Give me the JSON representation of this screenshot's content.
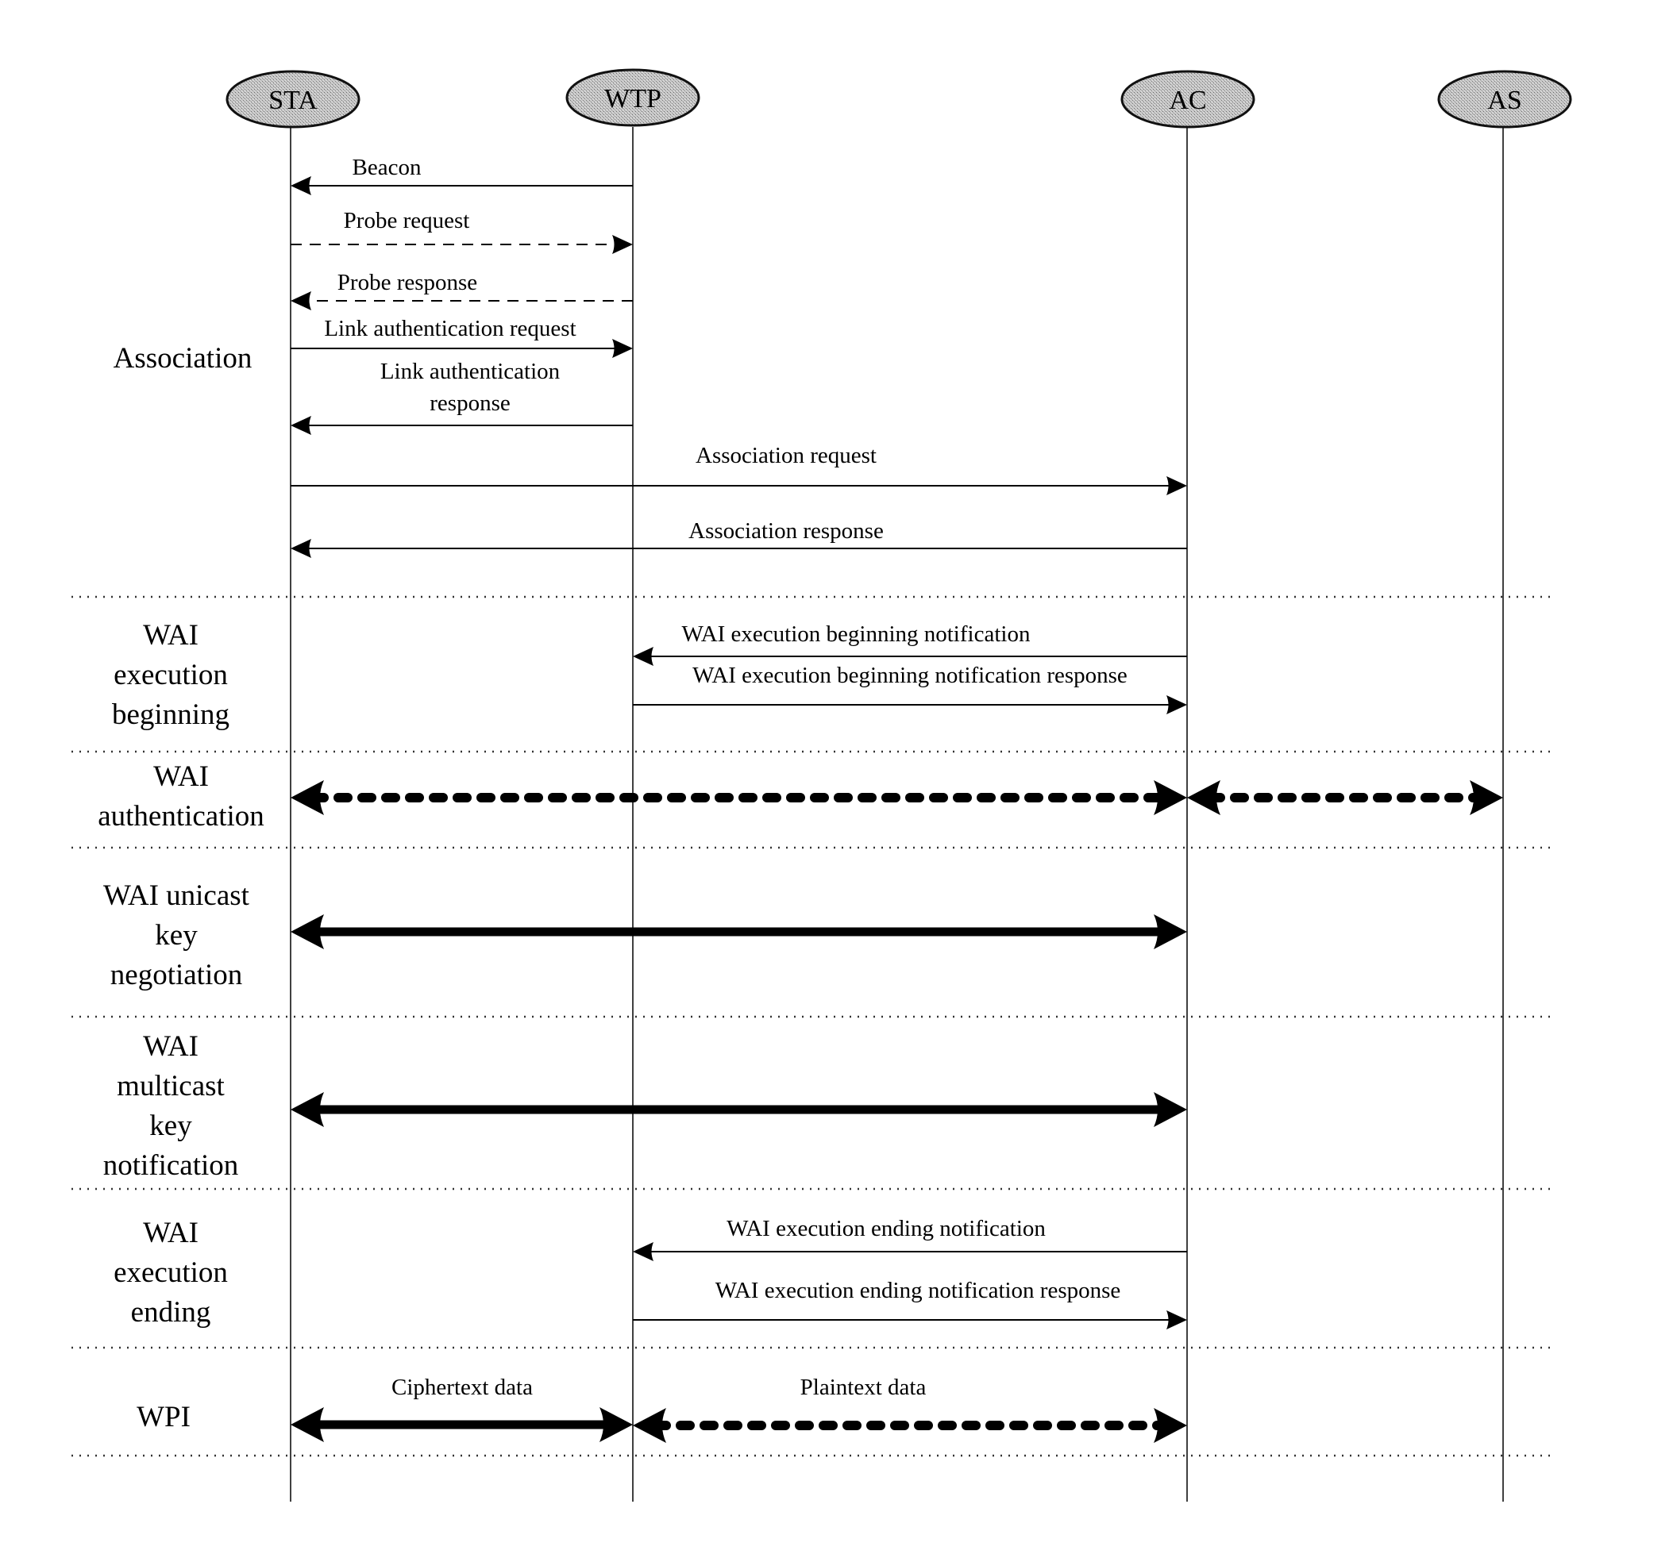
{
  "actors": [
    {
      "id": "sta",
      "label": "STA"
    },
    {
      "id": "wtp",
      "label": "WTP"
    },
    {
      "id": "ac",
      "label": "AC"
    },
    {
      "id": "as",
      "label": "AS"
    }
  ],
  "phases": [
    {
      "id": "association",
      "lines": [
        "Association"
      ]
    },
    {
      "id": "wai-execution-beginning",
      "lines": [
        "WAI",
        "execution",
        "beginning"
      ]
    },
    {
      "id": "wai-authentication",
      "lines": [
        "WAI",
        "authentication"
      ]
    },
    {
      "id": "wai-unicast-key-negotiation",
      "lines": [
        "WAI unicast",
        "key",
        "negotiation"
      ]
    },
    {
      "id": "wai-multicast-key-notification",
      "lines": [
        "WAI",
        "multicast",
        "key",
        "notification"
      ]
    },
    {
      "id": "wai-execution-ending",
      "lines": [
        "WAI",
        "execution",
        "ending"
      ]
    },
    {
      "id": "wpi",
      "lines": [
        "WPI"
      ]
    }
  ],
  "messages": [
    {
      "id": "beacon",
      "lines": [
        "Beacon"
      ],
      "from": "wtp",
      "to": "sta",
      "style": "solid"
    },
    {
      "id": "probe-request",
      "lines": [
        "Probe request"
      ],
      "from": "sta",
      "to": "wtp",
      "style": "dashed"
    },
    {
      "id": "probe-response",
      "lines": [
        "Probe response"
      ],
      "from": "wtp",
      "to": "sta",
      "style": "dashed"
    },
    {
      "id": "link-auth-request",
      "lines": [
        "Link authentication request"
      ],
      "from": "sta",
      "to": "wtp",
      "style": "solid"
    },
    {
      "id": "link-auth-response",
      "lines": [
        "Link authentication",
        "response"
      ],
      "from": "wtp",
      "to": "sta",
      "style": "solid"
    },
    {
      "id": "association-request",
      "lines": [
        "Association request"
      ],
      "from": "sta",
      "to": "ac",
      "style": "solid"
    },
    {
      "id": "association-response",
      "lines": [
        "Association response"
      ],
      "from": "ac",
      "to": "sta",
      "style": "solid"
    },
    {
      "id": "wai-exec-begin-notification",
      "lines": [
        "WAI execution beginning notification"
      ],
      "from": "ac",
      "to": "wtp",
      "style": "solid"
    },
    {
      "id": "wai-exec-begin-notification-response",
      "lines": [
        "WAI execution beginning notification response"
      ],
      "from": "wtp",
      "to": "ac",
      "style": "solid"
    },
    {
      "id": "wai-auth-sta-ac",
      "lines": [],
      "from": "sta",
      "to": "ac",
      "style": "dotted-thick",
      "bidirectional": true
    },
    {
      "id": "wai-auth-ac-as",
      "lines": [],
      "from": "ac",
      "to": "as",
      "style": "dotted-thick",
      "bidirectional": true
    },
    {
      "id": "wai-unicast-key",
      "lines": [],
      "from": "sta",
      "to": "ac",
      "style": "thick",
      "bidirectional": true
    },
    {
      "id": "wai-multicast-key",
      "lines": [],
      "from": "sta",
      "to": "ac",
      "style": "thick",
      "bidirectional": true
    },
    {
      "id": "wai-exec-end-notification",
      "lines": [
        "WAI execution ending notification"
      ],
      "from": "ac",
      "to": "wtp",
      "style": "solid"
    },
    {
      "id": "wai-exec-end-notification-response",
      "lines": [
        "WAI execution ending notification response"
      ],
      "from": "wtp",
      "to": "ac",
      "style": "solid"
    },
    {
      "id": "ciphertext-data",
      "lines": [
        "Ciphertext data"
      ],
      "from": "sta",
      "to": "wtp",
      "style": "thick",
      "bidirectional": true
    },
    {
      "id": "plaintext-data",
      "lines": [
        "Plaintext data"
      ],
      "from": "wtp",
      "to": "ac",
      "style": "dotted-thick",
      "bidirectional": true
    }
  ]
}
